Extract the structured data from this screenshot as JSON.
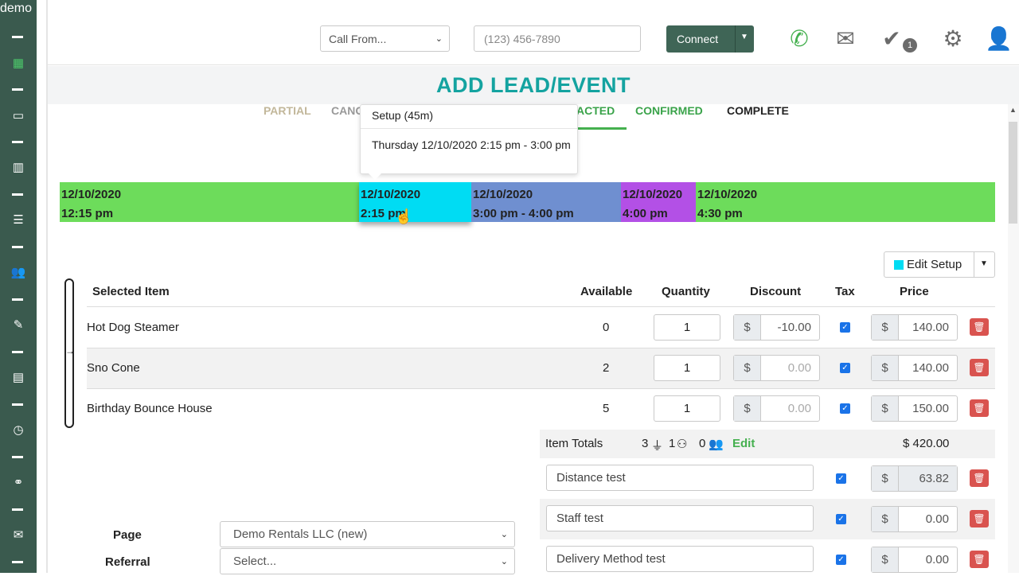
{
  "sidebar": {
    "brand": "demo",
    "icons": [
      "calendar-icon",
      "credit-card-icon",
      "building-icon",
      "list-icon",
      "users-icon",
      "user-edit-icon",
      "invoice-icon",
      "user-clock-icon",
      "link-icon",
      "mail-icon"
    ]
  },
  "topbar": {
    "call_from": "Call From...",
    "phone_placeholder": "(123) 456-7890",
    "connect": "Connect",
    "tasks_badge": "1"
  },
  "page": {
    "title": "ADD LEAD/EVENT"
  },
  "statuses": {
    "partial": "PARTIAL",
    "canceled": "CANC",
    "contracted": "ACTED",
    "confirmed": "CONFIRMED",
    "complete": "COMPLETE"
  },
  "tooltip": {
    "title": "Setup (45m)",
    "body": "Thursday 12/10/2020 2:15 pm - 3:00 pm"
  },
  "timeline": [
    {
      "date": "12/10/2020",
      "time": "12:15 pm",
      "color": "#6ddc5b"
    },
    {
      "date": "12/10/2020",
      "time": "2:15 pm",
      "color": "#00dcf3"
    },
    {
      "date": "12/10/2020",
      "time": "3:00 pm - 4:00 pm",
      "color": "#6f8fd0"
    },
    {
      "date": "12/10/2020",
      "time": "4:00 pm",
      "color": "#b350e6"
    },
    {
      "date": "12/10/2020",
      "time": "4:30 pm",
      "color": "#6ddc5b"
    }
  ],
  "edit_setup": {
    "label": "Edit Setup",
    "color": "#00dcf3"
  },
  "table": {
    "headers": {
      "item": "Selected Item",
      "available": "Available",
      "quantity": "Quantity",
      "discount": "Discount",
      "tax": "Tax",
      "price": "Price"
    },
    "currency": "$",
    "rows": [
      {
        "name": "Hot Dog Steamer",
        "available": "0",
        "quantity": "1",
        "discount": "-10.00",
        "price": "140.00"
      },
      {
        "name": "Sno Cone",
        "available": "2",
        "quantity": "1",
        "discount": "0.00",
        "price": "140.00"
      },
      {
        "name": "Birthday Bounce House",
        "available": "5",
        "quantity": "1",
        "discount": "0.00",
        "price": "150.00"
      }
    ]
  },
  "totals": {
    "label": "Item Totals",
    "power": "3",
    "staff": "1",
    "people": "0",
    "edit": "Edit",
    "amount": "$ 420.00"
  },
  "fees": [
    {
      "name": "Distance test",
      "amount": "63.82"
    },
    {
      "name": "Staff test",
      "amount": "0.00"
    },
    {
      "name": "Delivery Method test",
      "amount": "0.00"
    }
  ],
  "form": {
    "page_label": "Page",
    "page_value": "Demo Rentals LLC (new)",
    "referral_label": "Referral",
    "referral_value": "Select..."
  }
}
